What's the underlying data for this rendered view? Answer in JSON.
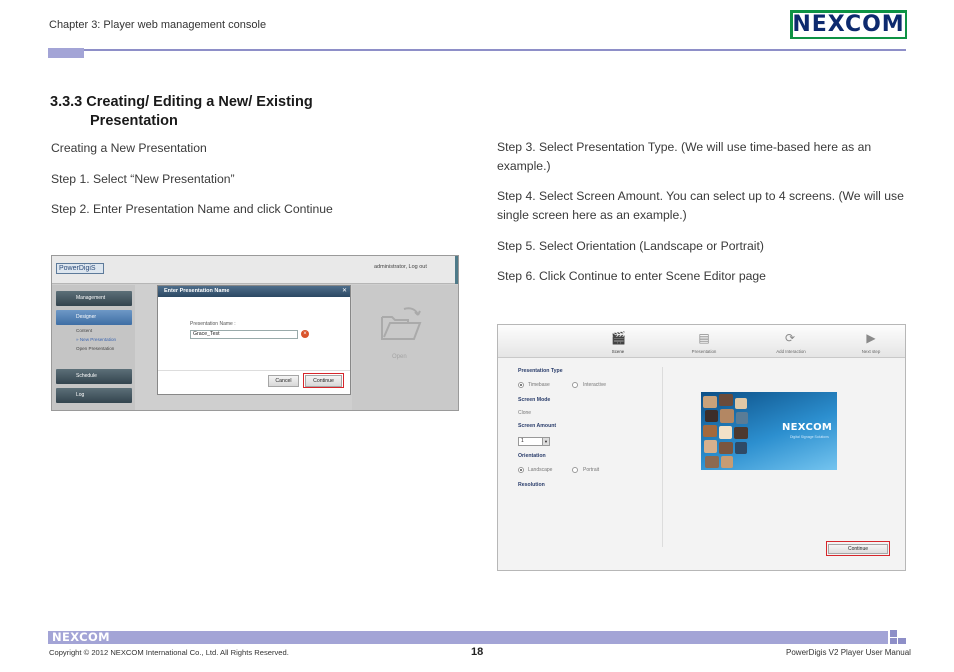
{
  "header": {
    "chapter": "Chapter 3: Player web management console",
    "logo": "NEXCOM"
  },
  "section": {
    "title_line1": "3.3.3 Creating/ Editing a New/ Existing",
    "title_line2": "Presentation"
  },
  "left_text": {
    "p1": "Creating a New Presentation",
    "p2": "Step 1. Select “New Presentation”",
    "p3": "Step 2. Enter Presentation Name and click Continue"
  },
  "right_text": {
    "s3": "Step 3. Select Presentation Type. (We will use time-based here as an example.)",
    "s4": "Step 4. Select Screen Amount. You can select up to 4 screens. (We will use single screen here as an example.)",
    "s5": "Step 5. Select Orientation (Landscape or Portrait)",
    "s6": "Step 6. Click Continue to enter Scene Editor page"
  },
  "screenshot1": {
    "brand": "PowerDigiS",
    "admin": "administrator,  Log out",
    "nav": [
      "Management",
      "Designer",
      "Schedule",
      "Log"
    ],
    "sub_items": [
      "Content",
      "» New Presentation",
      "Open Presentation"
    ],
    "dialog_title": "Enter Presentation Name",
    "field_label": "Presentation Name :",
    "field_value": "Grace_Test",
    "cancel": "Cancel",
    "continue": "Continue",
    "open": "Open"
  },
  "screenshot2": {
    "tools": [
      "Scene",
      "Presentation",
      "Add Interaction",
      "Next step"
    ],
    "presentation_type": "Presentation Type",
    "type_options": [
      "Timebase",
      "Interactive"
    ],
    "screen_mode": "Screen Mode",
    "screen_mode_value": "Clone",
    "screen_amount": "Screen Amount",
    "screen_amount_value": "1",
    "orientation": "Orientation",
    "orientation_options": [
      "Landscape",
      "Portrait"
    ],
    "resolution": "Resolution",
    "preview_logo": "NEXCOM",
    "preview_sub": "Digital Signage Solutions",
    "continue": "Continue"
  },
  "footer": {
    "logo": "NEXCOM",
    "copyright": "Copyright © 2012 NEXCOM International Co., Ltd. All Rights Reserved.",
    "page": "18",
    "manual": "PowerDigis V2 Player User Manual"
  },
  "colors": {
    "accent": "#a3a4d6",
    "logo_green": "#0d9244",
    "highlight_red": "#d6262b"
  }
}
